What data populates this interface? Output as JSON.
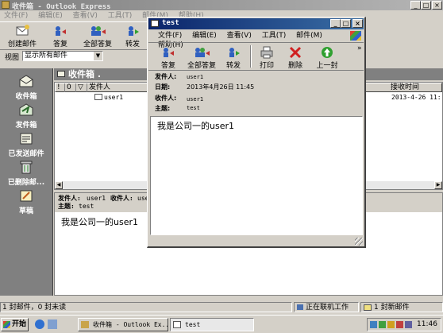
{
  "main_window": {
    "title": "收件箱 - Outlook Express",
    "menu": [
      "文件(F)",
      "编辑(E)",
      "查看(V)",
      "工具(T)",
      "邮件(M)",
      "帮助(H)"
    ],
    "toolbar": [
      "创建邮件",
      "答复",
      "全部答复",
      "转发"
    ],
    "view_label": "视图",
    "view_select": "显示所有邮件",
    "folder_title": "收件箱 .",
    "outbar": [
      "收件箱",
      "发件箱",
      "已发送邮件",
      "已删除邮...",
      "草稿"
    ],
    "columns": [
      "!",
      "0",
      "▽",
      "发件人",
      "接收时间"
    ],
    "messages": [
      {
        "sender": "user1",
        "received": "2013-4-26 11:"
      }
    ],
    "preview": {
      "from_label": "发件人:",
      "from_value": "user1",
      "to_label": "收件人:",
      "to_value": "use",
      "subject_label": "主题:",
      "subject_value": "test",
      "body": "我是公司一的user1"
    },
    "status": [
      "1 封邮件，0 封未读",
      "正在联机工作",
      "1 封新邮件"
    ]
  },
  "message_window": {
    "title": "test",
    "menu": [
      "文件(F)",
      "编辑(E)",
      "查看(V)",
      "工具(T)",
      "邮件(M)",
      "帮助(H)"
    ],
    "toolbar": [
      "答复",
      "全部答复",
      "转发",
      "打印",
      "删除",
      "上一封"
    ],
    "more": "»",
    "headers": [
      {
        "label": "发件人:",
        "value": "user1"
      },
      {
        "label": "日期:",
        "value": "2013年4月26日 11:45"
      },
      {
        "label": "收件人:",
        "value": "user1"
      },
      {
        "label": "主题:",
        "value": "test"
      }
    ],
    "body": "我是公司一的user1"
  },
  "taskbar": {
    "start": "开始",
    "tasks": [
      "收件箱 - Outlook Ex...",
      "test"
    ],
    "clock": "11:46"
  },
  "colors": {
    "title_active": "#0a246a",
    "outbar_bg": "#808080",
    "face": "#d4d0c8",
    "start_green": "#2e8b2e"
  }
}
